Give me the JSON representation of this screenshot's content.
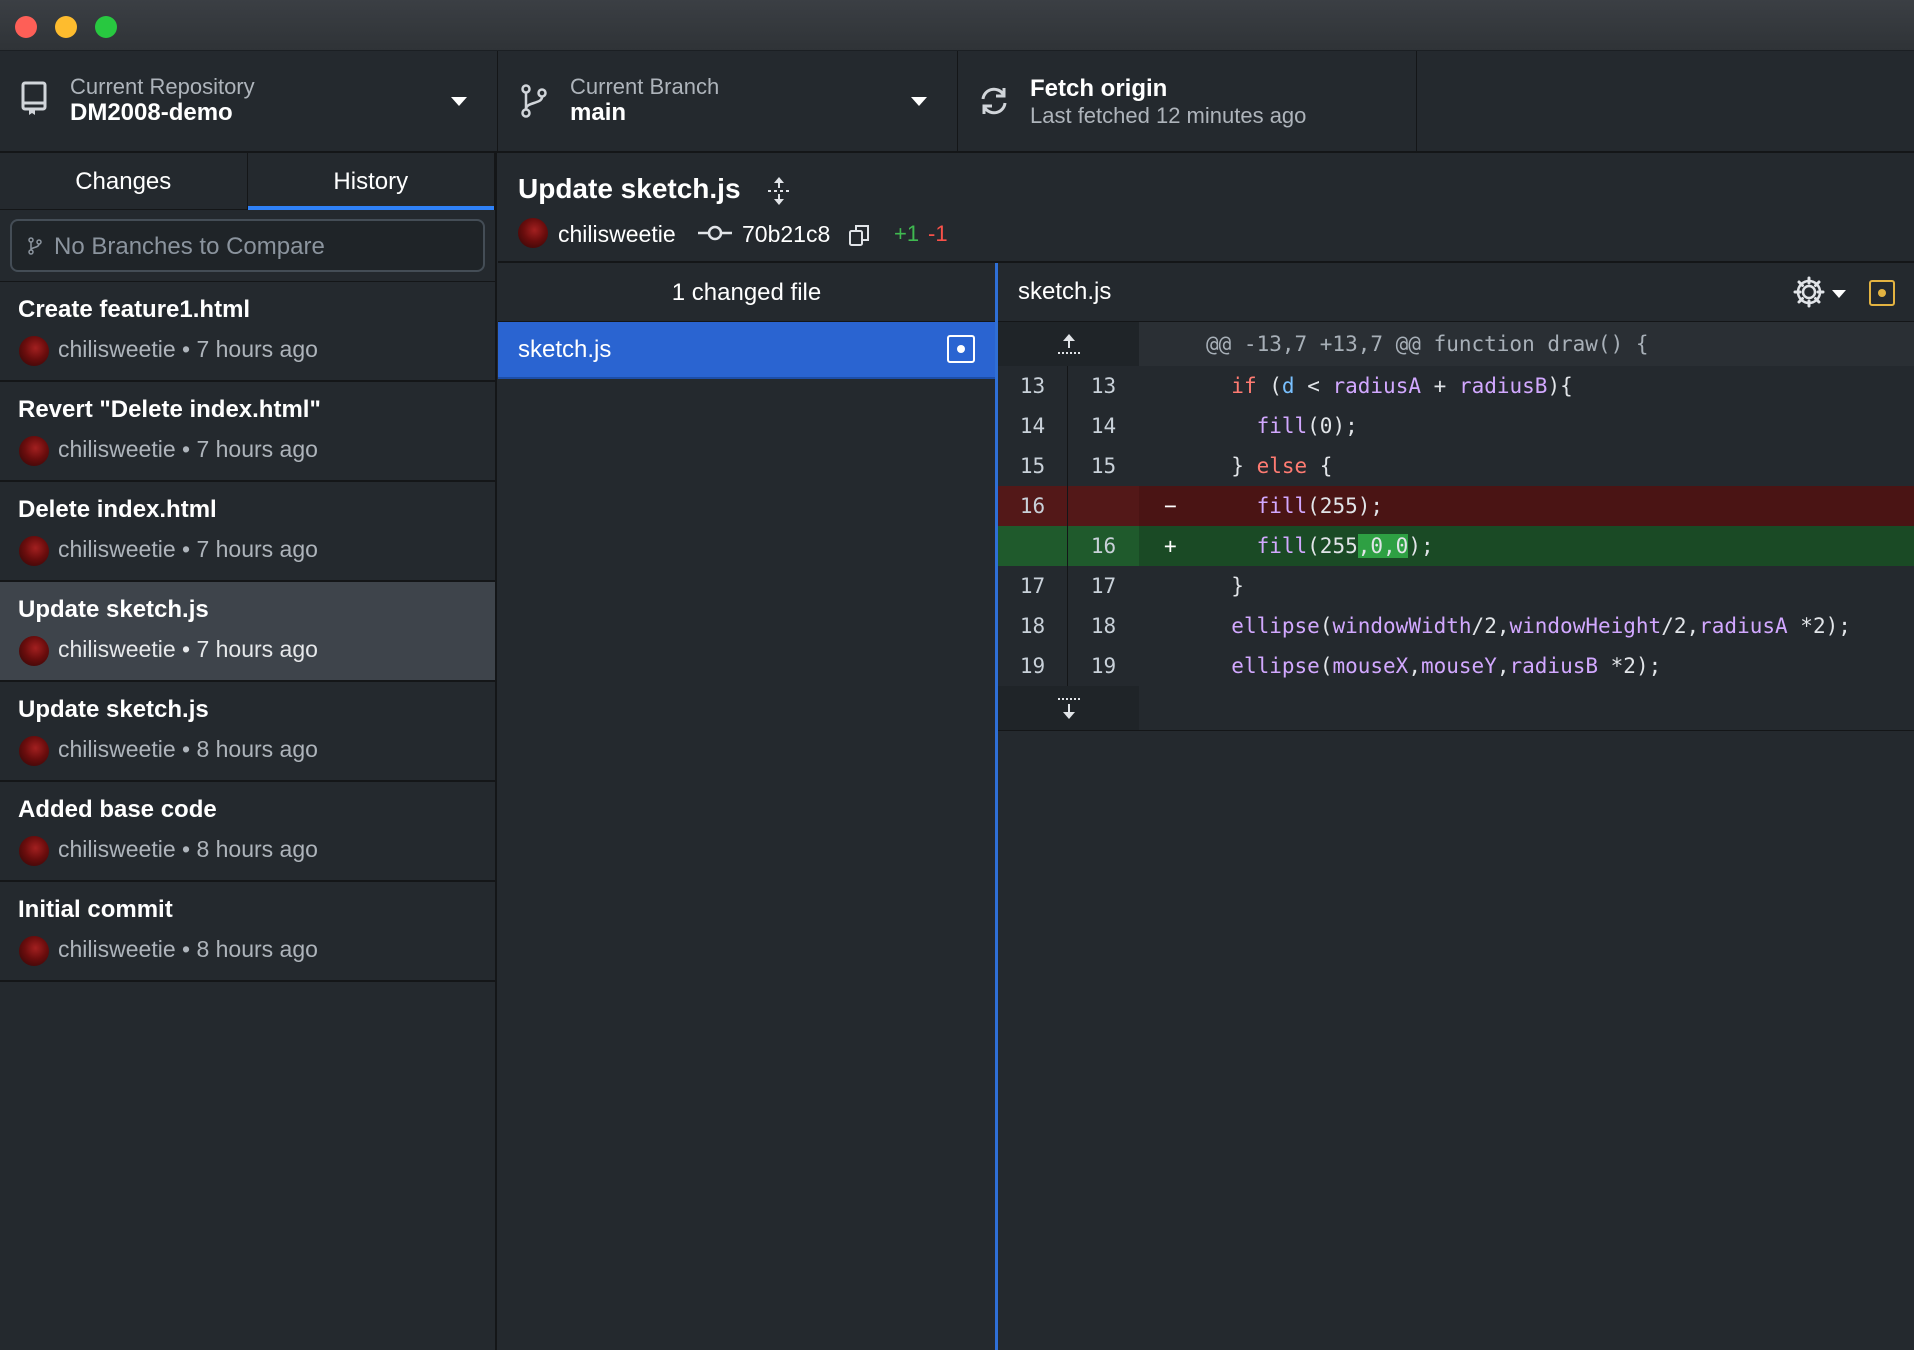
{
  "window": {
    "controls": [
      "close",
      "minimize",
      "zoom"
    ]
  },
  "toolbar": {
    "repo_label": "Current Repository",
    "repo_name": "DM2008-demo",
    "branch_label": "Current Branch",
    "branch_name": "main",
    "fetch_title": "Fetch origin",
    "fetch_subtitle": "Last fetched 12 minutes ago"
  },
  "sidebar": {
    "tabs": [
      {
        "label": "Changes",
        "active": false
      },
      {
        "label": "History",
        "active": true
      }
    ],
    "compare_placeholder": "No Branches to Compare",
    "commits": [
      {
        "title": "Create feature1.html",
        "meta": "chilisweetie • 7 hours ago",
        "selected": false
      },
      {
        "title": "Revert \"Delete index.html\"",
        "meta": "chilisweetie • 7 hours ago",
        "selected": false
      },
      {
        "title": "Delete index.html",
        "meta": "chilisweetie • 7 hours ago",
        "selected": false
      },
      {
        "title": "Update sketch.js",
        "meta": "chilisweetie • 7 hours ago",
        "selected": true
      },
      {
        "title": "Update sketch.js",
        "meta": "chilisweetie • 8 hours ago",
        "selected": false
      },
      {
        "title": "Added base code",
        "meta": "chilisweetie • 8 hours ago",
        "selected": false
      },
      {
        "title": "Initial commit",
        "meta": "chilisweetie • 8 hours ago",
        "selected": false
      }
    ]
  },
  "commit": {
    "title": "Update sketch.js",
    "author": "chilisweetie",
    "sha": "70b21c8",
    "additions": "+1",
    "deletions": "-1"
  },
  "files": {
    "header": "1 changed file",
    "items": [
      {
        "name": "sketch.js",
        "status": "modified"
      }
    ]
  },
  "diff": {
    "filename": "sketch.js",
    "hunk_header": "@@ -13,7 +13,7 @@ function draw() {",
    "lines": [
      {
        "old": "13",
        "new": "13",
        "type": "context",
        "text": "  if (d < radiusA + radiusB){"
      },
      {
        "old": "14",
        "new": "14",
        "type": "context",
        "text": "    fill(0);"
      },
      {
        "old": "15",
        "new": "15",
        "type": "context",
        "text": "  } else {"
      },
      {
        "old": "16",
        "new": "",
        "type": "del",
        "mark": "−",
        "text": "    fill(255);"
      },
      {
        "old": "",
        "new": "16",
        "type": "add",
        "mark": "+",
        "text": "    fill(255,0,0);"
      },
      {
        "old": "17",
        "new": "17",
        "type": "context",
        "text": "  }"
      },
      {
        "old": "18",
        "new": "18",
        "type": "context",
        "text": "  ellipse(windowWidth/2,windowHeight/2,radiusA *2);"
      },
      {
        "old": "19",
        "new": "19",
        "type": "context",
        "text": "  ellipse(mouseX,mouseY,radiusB *2);"
      }
    ]
  },
  "colors": {
    "accent": "#2f81f7",
    "selected_file_bg": "#2a64d1",
    "added": "#3fb950",
    "deleted": "#f85149",
    "modified_icon": "#e3b341"
  }
}
